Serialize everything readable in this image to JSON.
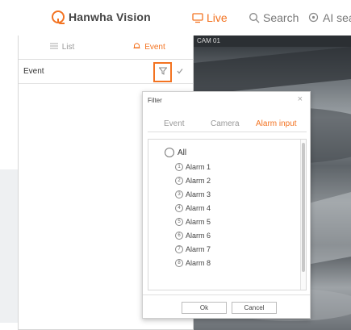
{
  "header": {
    "brand": "Hanwha Vision",
    "nav": [
      {
        "label": "Live",
        "active": true,
        "icon": "monitor-icon"
      },
      {
        "label": "Search",
        "icon": "search-icon"
      },
      {
        "label": "AI sea",
        "icon": "ai-search-icon"
      }
    ]
  },
  "left_pane": {
    "tabs": [
      {
        "label": "List",
        "icon": "list-icon"
      },
      {
        "label": "Event",
        "active": true,
        "icon": "bell-icon"
      }
    ],
    "event_row": {
      "label": "Event"
    }
  },
  "camera": {
    "label": "CAM 01"
  },
  "filter_dialog": {
    "title": "Filter",
    "close": "×",
    "tabs": [
      {
        "label": "Event"
      },
      {
        "label": "Camera"
      },
      {
        "label": "Alarm input",
        "active": true
      }
    ],
    "all_label": "All",
    "items": [
      {
        "num": "1",
        "label": "Alarm 1"
      },
      {
        "num": "2",
        "label": "Alarm 2"
      },
      {
        "num": "3",
        "label": "Alarm 3"
      },
      {
        "num": "4",
        "label": "Alarm 4"
      },
      {
        "num": "5",
        "label": "Alarm 5"
      },
      {
        "num": "6",
        "label": "Alarm 6"
      },
      {
        "num": "7",
        "label": "Alarm 7"
      },
      {
        "num": "8",
        "label": "Alarm 8"
      }
    ],
    "ok_label": "Ok",
    "cancel_label": "Cancel"
  },
  "colors": {
    "accent": "#f37321",
    "text": "#333333",
    "border": "#d6d6d6"
  }
}
